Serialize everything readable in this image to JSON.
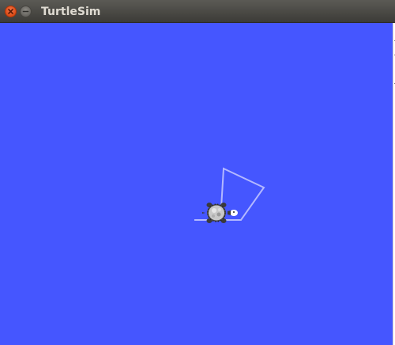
{
  "window": {
    "title": "TurtleSim",
    "background_color": "#4556ff",
    "pen_color": "#b3b8ff",
    "controls": [
      {
        "name": "close",
        "icon": "close-icon",
        "color": "#e9541f"
      },
      {
        "name": "minimize",
        "icon": "minimize-icon",
        "color": "#7d7b75"
      }
    ]
  },
  "turtle": {
    "icon": "turtle-icon",
    "shell_color": "#c8c8c8",
    "head_color": "#ffffff"
  }
}
